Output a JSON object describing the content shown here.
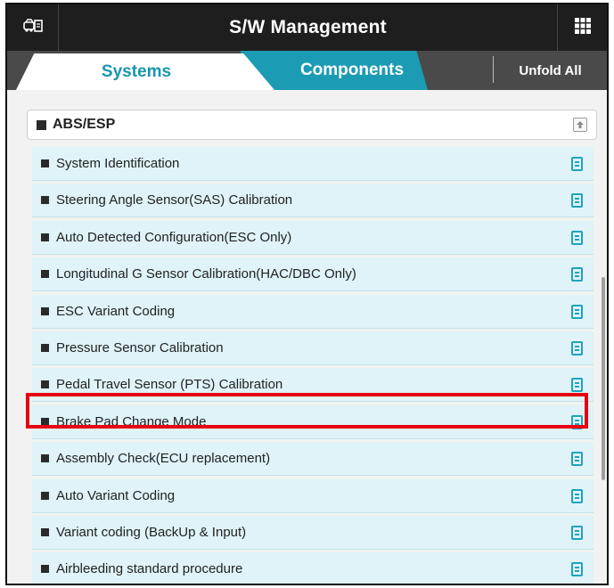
{
  "header": {
    "title": "S/W Management",
    "left_icon": "vehicle-doc-icon",
    "right_icon": "grid-menu-icon"
  },
  "tabs": [
    {
      "label": "Systems",
      "active": true
    },
    {
      "label": "Components",
      "active": false
    }
  ],
  "unfold_label": "Unfold All",
  "group": {
    "label": "ABS/ESP",
    "collapse_icon": "collapse-up-icon"
  },
  "items": [
    {
      "label": "System Identification"
    },
    {
      "label": "Steering Angle Sensor(SAS) Calibration"
    },
    {
      "label": "Auto Detected Configuration(ESC Only)"
    },
    {
      "label": "Longitudinal G Sensor Calibration(HAC/DBC Only)"
    },
    {
      "label": "ESC Variant Coding"
    },
    {
      "label": "Pressure Sensor Calibration"
    },
    {
      "label": "Pedal Travel Sensor (PTS) Calibration"
    },
    {
      "label": "Brake Pad Change Mode",
      "highlighted": true
    },
    {
      "label": "Assembly Check(ECU replacement)"
    },
    {
      "label": "Auto Variant Coding"
    },
    {
      "label": "Variant coding (BackUp & Input)"
    },
    {
      "label": "Airbleeding standard procedure"
    }
  ],
  "colors": {
    "accent": "#1c9bb4",
    "row_bg": "#dff3f8",
    "highlight": "#e60012",
    "header_bg": "#1e1e1e"
  }
}
